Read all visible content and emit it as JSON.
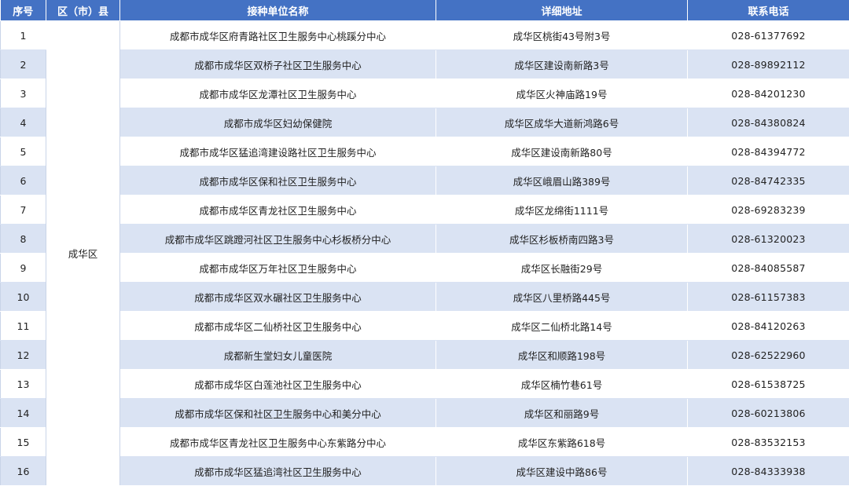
{
  "headers": {
    "seq": "序号",
    "district": "区（市）县",
    "name": "接种单位名称",
    "address": "详细地址",
    "phone": "联系电话"
  },
  "district": "成华区",
  "rows": [
    {
      "seq": "1",
      "name": "成都市成华区府青路社区卫生服务中心桃蹊分中心",
      "address": "成华区桃街43号附3号",
      "phone": "028-61377692"
    },
    {
      "seq": "2",
      "name": "成都市成华区双桥子社区卫生服务中心",
      "address": "成华区建设南新路3号",
      "phone": "028-89892112"
    },
    {
      "seq": "3",
      "name": "成都市成华区龙潭社区卫生服务中心",
      "address": "成华区火神庙路19号",
      "phone": "028-84201230"
    },
    {
      "seq": "4",
      "name": "成都市成华区妇幼保健院",
      "address": "成华区成华大道新鸿路6号",
      "phone": "028-84380824"
    },
    {
      "seq": "5",
      "name": "成都市成华区猛追湾建设路社区卫生服务中心",
      "address": "成华区建设南新路80号",
      "phone": "028-84394772"
    },
    {
      "seq": "6",
      "name": "成都市成华区保和社区卫生服务中心",
      "address": "成华区峨眉山路389号",
      "phone": "028-84742335"
    },
    {
      "seq": "7",
      "name": "成都市成华区青龙社区卫生服务中心",
      "address": "成华区龙绵街1111号",
      "phone": "028-69283239"
    },
    {
      "seq": "8",
      "name": "成都市成华区跳蹬河社区卫生服务中心杉板桥分中心",
      "address": "成华区杉板桥南四路3号",
      "phone": "028-61320023"
    },
    {
      "seq": "9",
      "name": "成都市成华区万年社区卫生服务中心",
      "address": "成华区长融街29号",
      "phone": "028-84085587"
    },
    {
      "seq": "10",
      "name": "成都市成华区双水碾社区卫生服务中心",
      "address": "成华区八里桥路445号",
      "phone": "028-61157383"
    },
    {
      "seq": "11",
      "name": "成都市成华区二仙桥社区卫生服务中心",
      "address": "成华区二仙桥北路14号",
      "phone": "028-84120263"
    },
    {
      "seq": "12",
      "name": "成都新生堂妇女儿童医院",
      "address": "成华区和顺路198号",
      "phone": "028-62522960"
    },
    {
      "seq": "13",
      "name": "成都市成华区白莲池社区卫生服务中心",
      "address": "成华区楠竹巷61号",
      "phone": "028-61538725"
    },
    {
      "seq": "14",
      "name": "成都市成华区保和社区卫生服务中心和美分中心",
      "address": "成华区和丽路9号",
      "phone": "028-60213806"
    },
    {
      "seq": "15",
      "name": "成都市成华区青龙社区卫生服务中心东紫路分中心",
      "address": "成华区东紫路618号",
      "phone": "028-83532153"
    },
    {
      "seq": "16",
      "name": "成都市成华区猛追湾社区卫生服务中心",
      "address": "成华区建设中路86号",
      "phone": "028-84333938"
    }
  ]
}
